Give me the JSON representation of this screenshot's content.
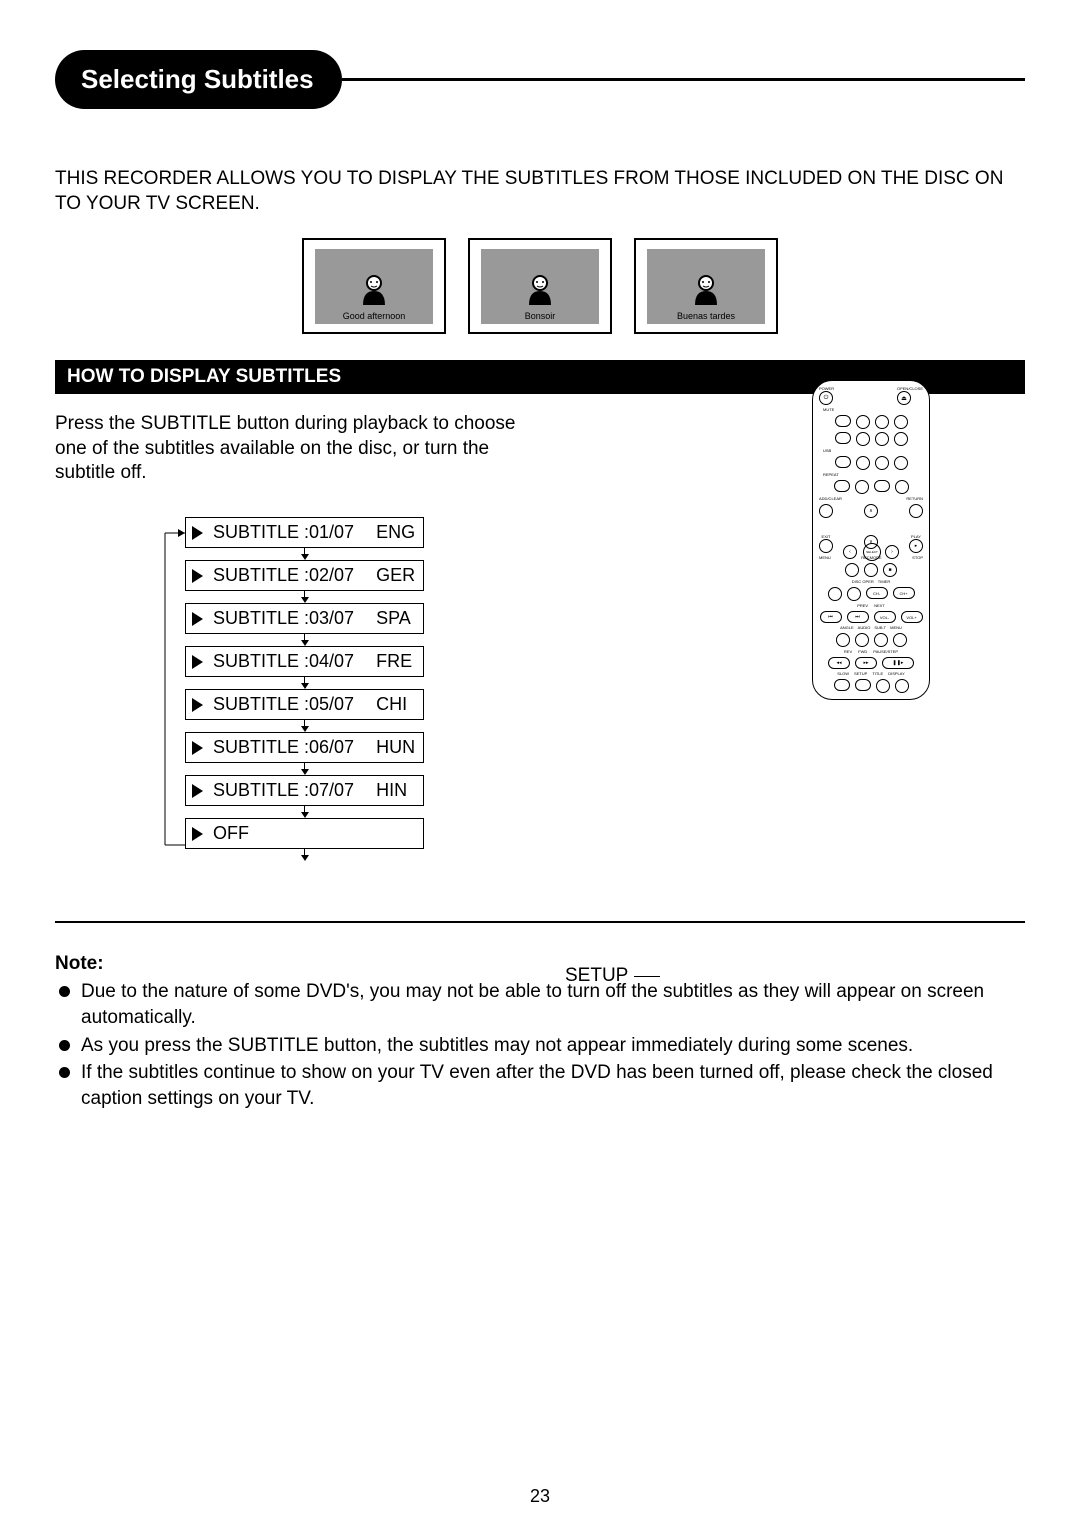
{
  "title": "Selecting Subtitles",
  "intro": "THIS RECORDER ALLOWS YOU TO DISPLAY THE SUBTITLES FROM THOSE INCLUDED ON THE DISC ON TO YOUR TV SCREEN.",
  "tvs": [
    {
      "caption": "Good afternoon"
    },
    {
      "caption": "Bonsoir"
    },
    {
      "caption": "Buenas tardes"
    }
  ],
  "section1": "HOW TO DISPLAY SUBTITLES",
  "step1": "Press the SUBTITLE button during playback to choose one of the subtitles available on the disc, or turn the subtitle off.",
  "subtitles": [
    {
      "label": "SUBTITLE :01/07",
      "lang": "ENG"
    },
    {
      "label": "SUBTITLE :02/07",
      "lang": "GER"
    },
    {
      "label": "SUBTITLE :03/07",
      "lang": "SPA"
    },
    {
      "label": "SUBTITLE :04/07",
      "lang": "FRE"
    },
    {
      "label": "SUBTITLE :05/07",
      "lang": "CHI"
    },
    {
      "label": "SUBTITLE :06/07",
      "lang": "HUN"
    },
    {
      "label": "SUBTITLE :07/07",
      "lang": "HIN"
    }
  ],
  "off_label": "OFF",
  "setup_callout": "SETUP",
  "remote_labels": {
    "power": "POWER",
    "openclose": "OPEN/CLOSE",
    "mute": "MUTE",
    "usb": "USB",
    "repeat": "REPEAT",
    "add_clear": "ADD/CLEAR",
    "return": "RETURN",
    "select": "SELECT",
    "exit": "EXIT",
    "play": "PLAY",
    "menu": "MENU",
    "recmode": "RECMODE",
    "stop": "STOP",
    "discoper": "DISC OPER",
    "timer": "TIMER",
    "ch_minus": "CH-",
    "ch_plus": "CH+",
    "prev": "PREV",
    "next": "NEXT",
    "vol_minus": "VOL-",
    "vol_plus": "VOL+",
    "angle": "ANGLE",
    "audio": "AUDIO",
    "subt": "SUB.T",
    "menu2": "MENU",
    "rev": "REV",
    "fwd": "FWD",
    "pause_step": "PAUSE/STEP",
    "slow": "SLOW",
    "setup": "SETUP",
    "title": "TITLE",
    "display": "DISPLAY"
  },
  "note_title": "Note:",
  "notes": [
    "Due to the nature of some DVD's, you may not be able to turn off the subtitles as they will appear on screen automatically.",
    "As you press the SUBTITLE button, the subtitles may not appear immediately during some scenes.",
    "If the subtitles continue to show on your TV even after the DVD has been turned off, please check the closed caption settings on your TV."
  ],
  "page_num": "23"
}
